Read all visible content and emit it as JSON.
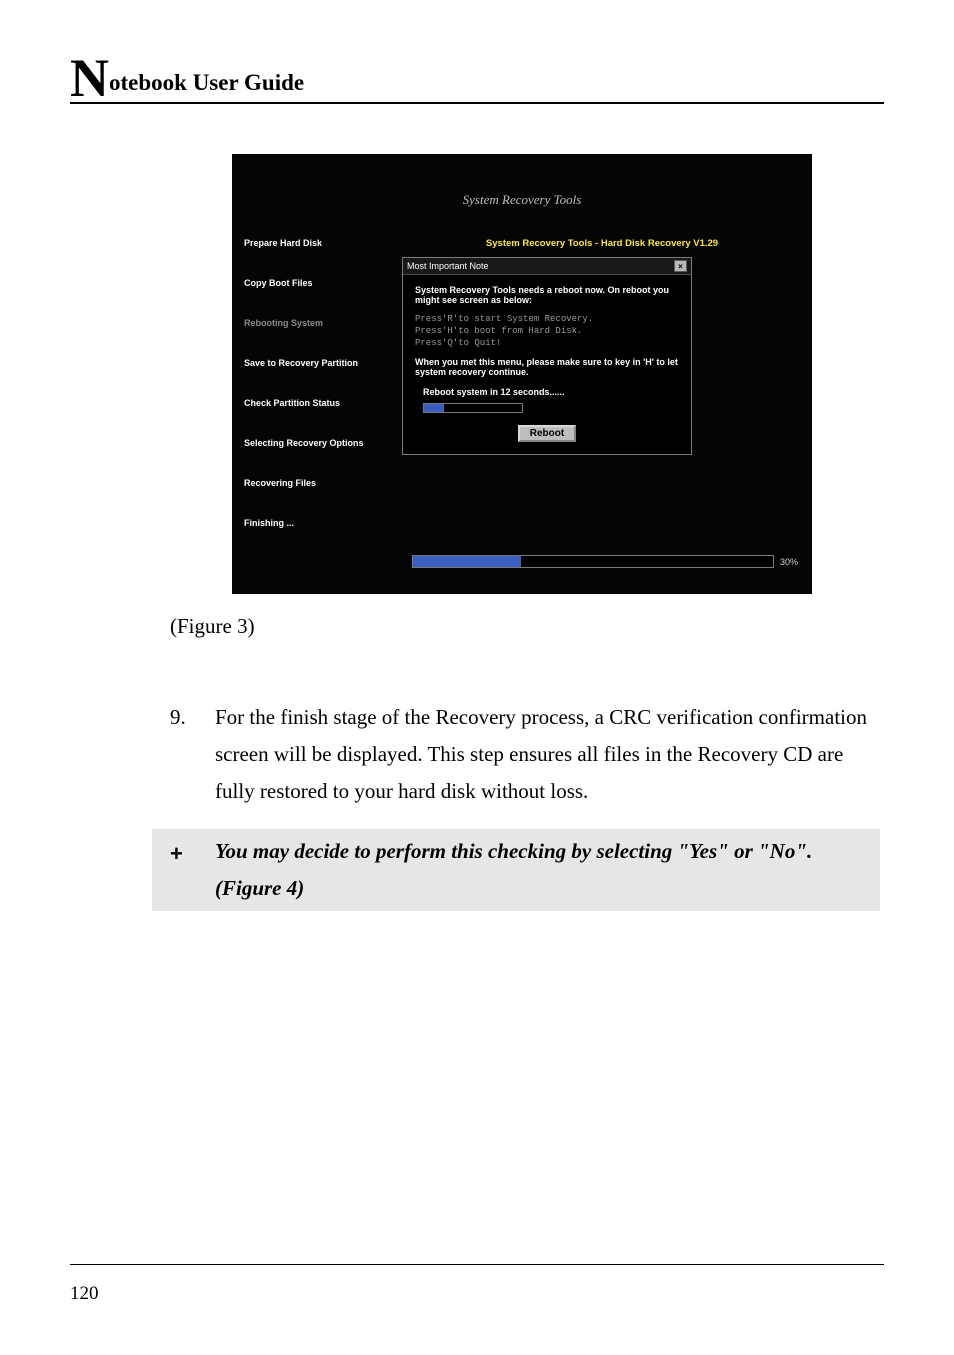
{
  "header": {
    "big_letter": "N",
    "rest": "otebook User Guide"
  },
  "screenshot": {
    "app_title": "System Recovery Tools",
    "sidebar": [
      {
        "label": "Prepare Hard Disk",
        "active": true
      },
      {
        "label": "Copy Boot Files",
        "active": true
      },
      {
        "label": "Rebooting System",
        "active": false
      },
      {
        "label": "Save to Recovery Partition",
        "active": true
      },
      {
        "label": "Check Partition Status",
        "active": true
      },
      {
        "label": "Selecting Recovery Options",
        "active": true
      },
      {
        "label": "Recovering Files",
        "active": true
      },
      {
        "label": "Finishing ...",
        "active": true
      }
    ],
    "main_title": "System Recovery Tools - Hard Disk Recovery V1.29",
    "dialog": {
      "title": "Most Important Note",
      "line1": "System Recovery Tools needs a reboot now. On reboot you might see screen as below:",
      "mono": "Press'R'to start System Recovery.\nPress'H'to boot from Hard Disk.\nPress'Q'to Quit!",
      "line2": "When you met this menu, please make sure to key in 'H' to let system recovery continue.",
      "countdown": "Reboot system in 12 seconds......",
      "button": "Reboot"
    },
    "overall_progress": "30%"
  },
  "caption": "(Figure 3)",
  "step": {
    "num": "9.",
    "text": "For the finish stage of the Recovery process, a CRC verification confirmation screen will be displayed.  This step ensures all files in the Recovery CD are fully restored to your hard disk without loss."
  },
  "note": {
    "symbol": "+",
    "text": "You may decide to perform this checking by selecting \"Yes\" or \"No\". (Figure 4)"
  },
  "page_number": "120"
}
